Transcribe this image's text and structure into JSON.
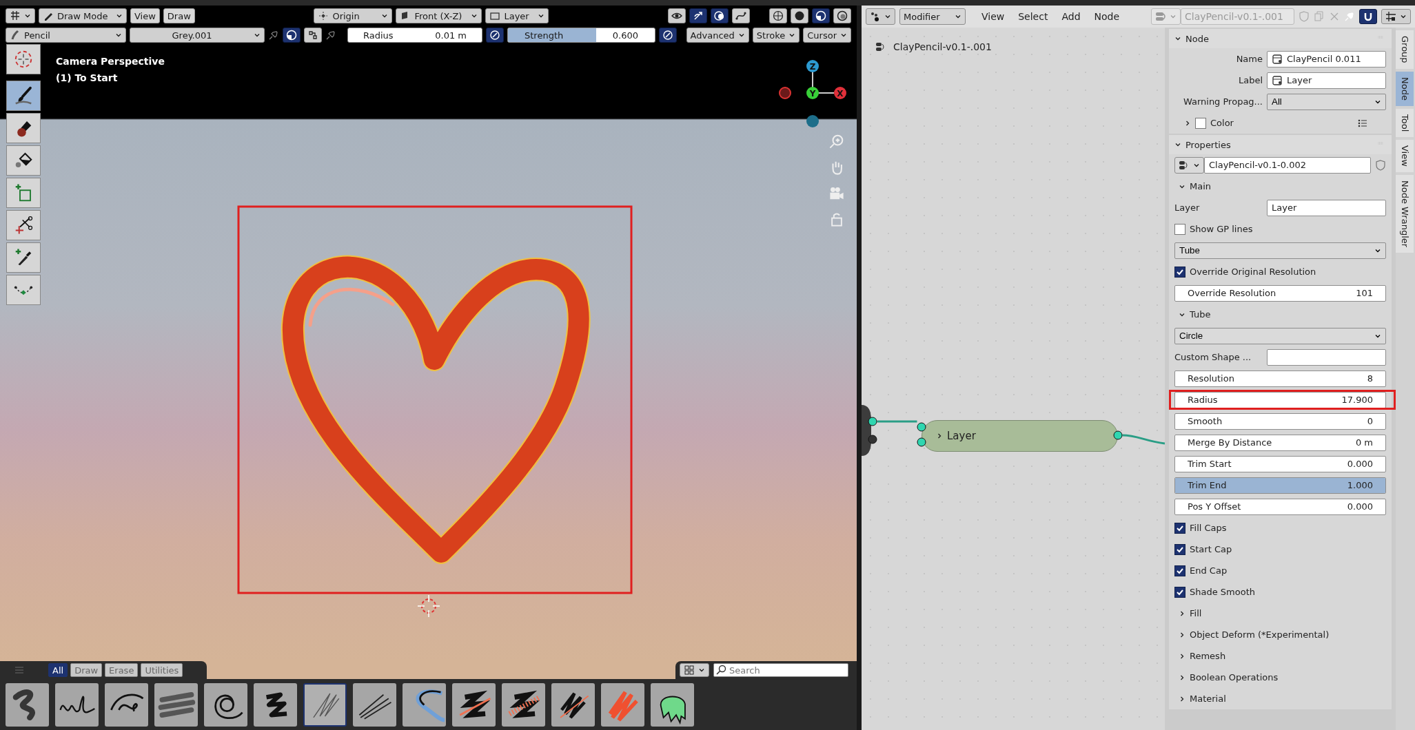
{
  "viewport_header": {
    "row1": {
      "mode": {
        "label": "Draw Mode"
      },
      "menus": [
        {
          "label": "View"
        },
        {
          "label": "Draw"
        }
      ],
      "pivot": {
        "label": "Origin"
      },
      "orientation": {
        "label": "Front (X-Z)"
      },
      "layer": {
        "label": "Layer"
      },
      "toggles": [
        {
          "selected": false
        },
        {
          "selected": true
        },
        {
          "selected": true
        },
        {
          "selected": false
        }
      ],
      "shading": [
        {
          "selected": false
        },
        {
          "selected": false
        },
        {
          "selected": true
        },
        {
          "selected": false
        }
      ]
    },
    "row2": {
      "brush": {
        "label": "Pencil"
      },
      "material": {
        "label": "Grey.001"
      },
      "material_toggles": [
        {
          "selected": true
        },
        {
          "selected": false
        }
      ],
      "radius": {
        "label": "Radius",
        "value": "0.01 m",
        "pressure": true
      },
      "strength": {
        "label": "Strength",
        "value": "0.600",
        "level": 0.6,
        "pressure": true
      },
      "menus": [
        {
          "label": "Advanced"
        },
        {
          "label": "Stroke"
        },
        {
          "label": "Cursor"
        }
      ]
    }
  },
  "viewport": {
    "overlay_text": [
      "Camera Perspective",
      "(1) To Start"
    ],
    "gizmo_labels": [
      "Z",
      "Y",
      "X"
    ],
    "highlight_frame": true,
    "tools": [
      {
        "selected": false
      },
      {
        "selected": true
      },
      {
        "selected": false
      },
      {
        "selected": false
      },
      {
        "selected": false
      },
      {
        "selected": false
      },
      {
        "selected": false
      },
      {
        "selected": false
      }
    ]
  },
  "asset_shelf": {
    "tabs": [
      {
        "label": "All",
        "selected": true
      },
      {
        "label": "Draw",
        "selected": false
      },
      {
        "label": "Erase",
        "selected": false
      },
      {
        "label": "Utilities",
        "selected": false
      }
    ],
    "search": {
      "placeholder": "Search"
    },
    "brushes": [
      {
        "selected": false
      },
      {
        "selected": false
      },
      {
        "selected": false
      },
      {
        "selected": false
      },
      {
        "selected": false
      },
      {
        "selected": false
      },
      {
        "selected": true
      },
      {
        "selected": false
      },
      {
        "selected": false
      },
      {
        "selected": false
      },
      {
        "selected": false
      },
      {
        "selected": false
      },
      {
        "selected": false
      },
      {
        "selected": false
      }
    ]
  },
  "node_editor": {
    "header": {
      "editor": "Modifier",
      "menus": [
        {
          "label": "View"
        },
        {
          "label": "Select"
        },
        {
          "label": "Add"
        },
        {
          "label": "Node"
        }
      ],
      "node_group": "ClayPencil-v0.1-.001"
    },
    "breadcrumb": "ClayPencil-v0.1-.001",
    "node": {
      "label": "Layer",
      "expanded": false
    },
    "sidebar": {
      "panels": [
        {
          "title": "Node",
          "expanded": true,
          "rows": [
            {
              "kind": "labeled_field",
              "label": "Name",
              "value": "ClayPencil 0.011"
            },
            {
              "kind": "labeled_field",
              "label": "Label",
              "value": "Layer"
            },
            {
              "kind": "labeled_dropdown",
              "label": "Warning Propag...",
              "value": "All"
            },
            {
              "kind": "color",
              "label": "Color",
              "expanded": false,
              "checked": false
            }
          ]
        },
        {
          "title": "Properties",
          "expanded": true,
          "rows": [
            {
              "kind": "datablock",
              "value": "ClayPencil-v0.1-0.002"
            },
            {
              "kind": "subpanel",
              "label": "Main",
              "expanded": true
            },
            {
              "kind": "text_field",
              "label": "Layer",
              "value": "Layer"
            },
            {
              "kind": "check",
              "label": "Show GP lines",
              "checked": false
            },
            {
              "kind": "dropdown",
              "value": "Tube"
            },
            {
              "kind": "check",
              "label": "Override Original Resolution",
              "checked": true
            },
            {
              "kind": "number",
              "label": "Override  Resolution",
              "value": "101"
            },
            {
              "kind": "subpanel",
              "label": "Tube",
              "expanded": true
            },
            {
              "kind": "dropdown",
              "value": "Circle"
            },
            {
              "kind": "text_field",
              "label": "Custom Shape ..."
            },
            {
              "kind": "number",
              "label": "Resolution",
              "value": "8"
            },
            {
              "kind": "number",
              "label": "Radius",
              "value": "17.900",
              "highlighted": true
            },
            {
              "kind": "number",
              "label": "Smooth",
              "value": "0"
            },
            {
              "kind": "number",
              "label": "Merge By Distance",
              "value": "0 m"
            },
            {
              "kind": "number",
              "label": "Trim Start",
              "value": "0.000"
            },
            {
              "kind": "number",
              "label": "Trim End",
              "value": "1.000",
              "level": 1
            },
            {
              "kind": "number",
              "label": "Pos Y Offset",
              "value": "0.000"
            },
            {
              "kind": "check",
              "label": "Fill Caps",
              "checked": true
            },
            {
              "kind": "check",
              "label": "Start Cap",
              "checked": true
            },
            {
              "kind": "check",
              "label": "End Cap",
              "checked": true
            },
            {
              "kind": "check",
              "label": "Shade Smooth",
              "checked": true
            },
            {
              "kind": "subpanel",
              "label": "Fill",
              "expanded": false
            },
            {
              "kind": "subpanel",
              "label": "Object Deform (*Experimental)",
              "expanded": false
            },
            {
              "kind": "subpanel",
              "label": "Remesh",
              "expanded": false
            },
            {
              "kind": "subpanel",
              "label": "Boolean Operations",
              "expanded": false
            },
            {
              "kind": "subpanel",
              "label": "Material",
              "expanded": false
            }
          ]
        }
      ]
    },
    "tabs": [
      {
        "label": "Group",
        "selected": false
      },
      {
        "label": "Node",
        "selected": true
      },
      {
        "label": "Tool",
        "selected": false
      },
      {
        "label": "View",
        "selected": false
      },
      {
        "label": "Node Wrangler",
        "selected": false
      }
    ]
  }
}
